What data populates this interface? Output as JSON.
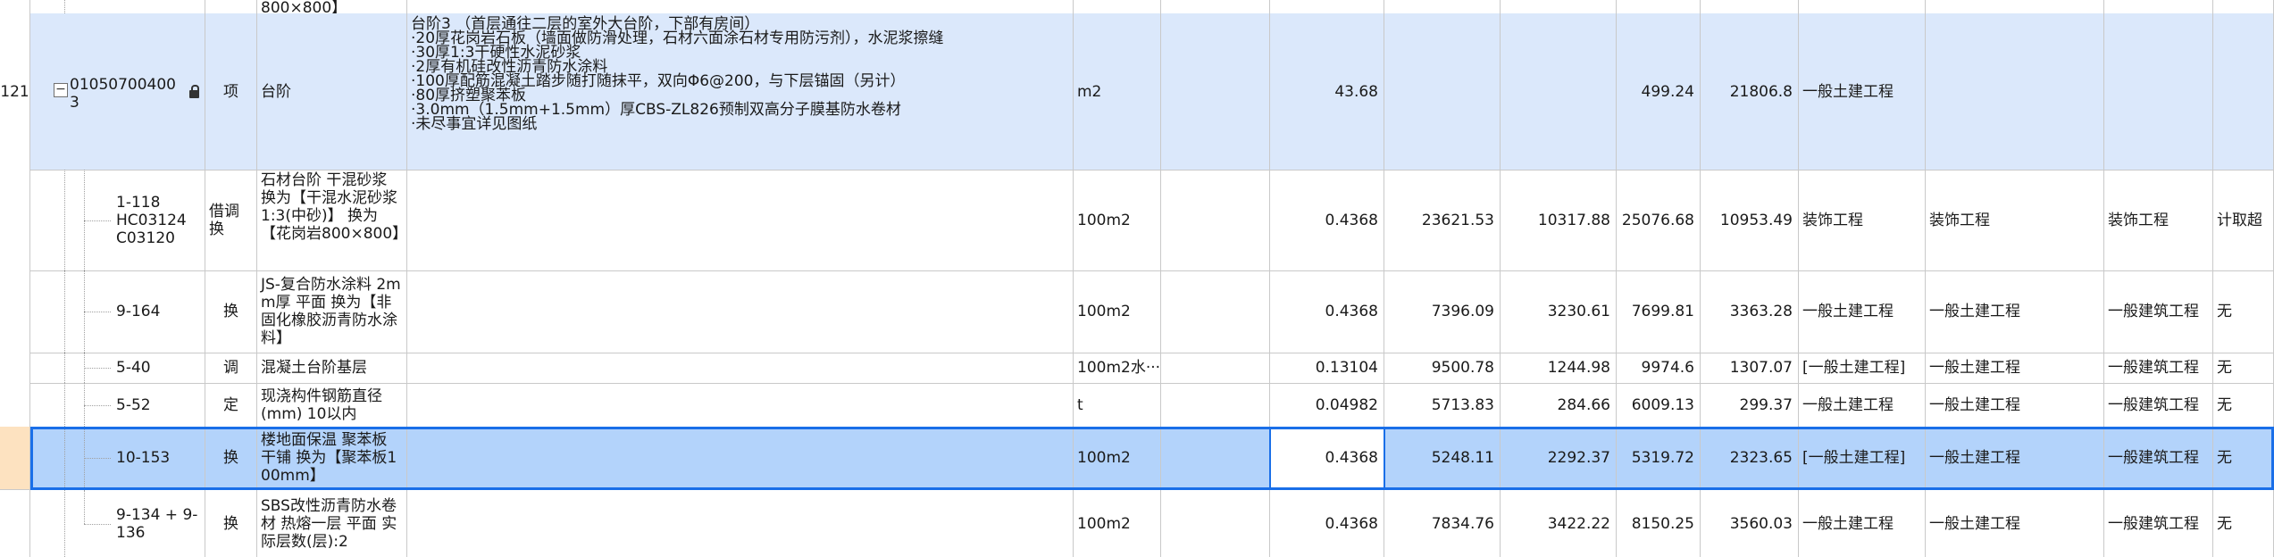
{
  "rows": {
    "top": {
      "name": "800×800】"
    },
    "r121": {
      "rownum": "121",
      "code_a": "01050700400",
      "code_b": "3",
      "type": "项",
      "name": "台阶",
      "desc": "台阶3 （首层通往二层的室外大台阶，下部有房间）\n·20厚花岗岩石板（墙面做防滑处理，石材六面涂石材专用防污剂），水泥浆擦缝\n·30厚1:3干硬性水泥砂浆\n·2厚有机硅改性沥青防水涂料\n·100厚配筋混凝土踏步随打随抹平，双向Φ6@200，与下层锚固（另计）\n·80厚挤塑聚苯板\n·3.0mm（1.5mm+1.5mm）厚CBS-ZL826预制双高分子膜基防水卷材\n·未尽事宜详见图纸",
      "unit": "m2",
      "qty": "43.68",
      "c6": "",
      "c7": "",
      "c8": "499.24",
      "c9": "21806.8",
      "spec": "一般土建工程",
      "spec2": "",
      "spec3": "",
      "flag": ""
    },
    "r1": {
      "code": "1-118 HC03124\nC03120",
      "type": "借调换",
      "name": "石材台阶 干混砂浆 换为【干混水泥砂浆 1:3(中砂)】 换为【花岗岩800×800】",
      "unit": "100m2",
      "qty": "0.4368",
      "c6": "23621.53",
      "c7": "10317.88",
      "c8": "25076.68",
      "c9": "10953.49",
      "spec": "装饰工程",
      "spec2": "装饰工程",
      "spec3": "装饰工程",
      "flag": "计取超"
    },
    "r2": {
      "code": "9-164",
      "type": "换",
      "name": "JS-复合防水涂料 2mm厚 平面 换为【非固化橡胶沥青防水涂料】",
      "unit": "100m2",
      "qty": "0.4368",
      "c6": "7396.09",
      "c7": "3230.61",
      "c8": "7699.81",
      "c9": "3363.28",
      "spec": "一般土建工程",
      "spec2": "一般土建工程",
      "spec3": "一般建筑工程",
      "flag": "无"
    },
    "r3": {
      "code": "5-40",
      "type": "调",
      "name": "混凝土台阶基层",
      "unit": "100m2水···",
      "qty": "0.13104",
      "c6": "9500.78",
      "c7": "1244.98",
      "c8": "9974.6",
      "c9": "1307.07",
      "spec": "[一般土建工程]",
      "spec2": "一般土建工程",
      "spec3": "一般建筑工程",
      "flag": "无"
    },
    "r4": {
      "code": "5-52",
      "type": "定",
      "name": "现浇构件钢筋直径(mm) 10以内",
      "unit": "t",
      "qty": "0.04982",
      "c6": "5713.83",
      "c7": "284.66",
      "c8": "6009.13",
      "c9": "299.37",
      "spec": "一般土建工程",
      "spec2": "一般土建工程",
      "spec3": "一般建筑工程",
      "flag": "无"
    },
    "r5": {
      "code": "10-153",
      "type": "换",
      "name": "楼地面保温 聚苯板 干铺 换为【聚苯板100mm】",
      "unit": "100m2",
      "qty": "0.4368",
      "c6": "5248.11",
      "c7": "2292.37",
      "c8": "5319.72",
      "c9": "2323.65",
      "spec": "[一般土建工程]",
      "spec2": "一般土建工程",
      "spec3": "一般建筑工程",
      "flag": "无"
    },
    "r6": {
      "code": "9-134 + 9-136",
      "type": "换",
      "name": "SBS改性沥青防水卷材 热熔一层 平面 实际层数(层):2",
      "unit": "100m2",
      "qty": "0.4368",
      "c6": "7834.76",
      "c7": "3422.22",
      "c8": "8150.25",
      "c9": "3560.03",
      "spec": "一般土建工程",
      "spec2": "一般土建工程",
      "spec3": "一般建筑工程",
      "flag": "无"
    }
  },
  "icons": {
    "expander": "minus-expander-icon",
    "lock": "lock-icon"
  },
  "colors": {
    "item_row": "#dbe8fb",
    "selected_row": "#b3d3fb",
    "selection_border": "#1a6fe8"
  }
}
